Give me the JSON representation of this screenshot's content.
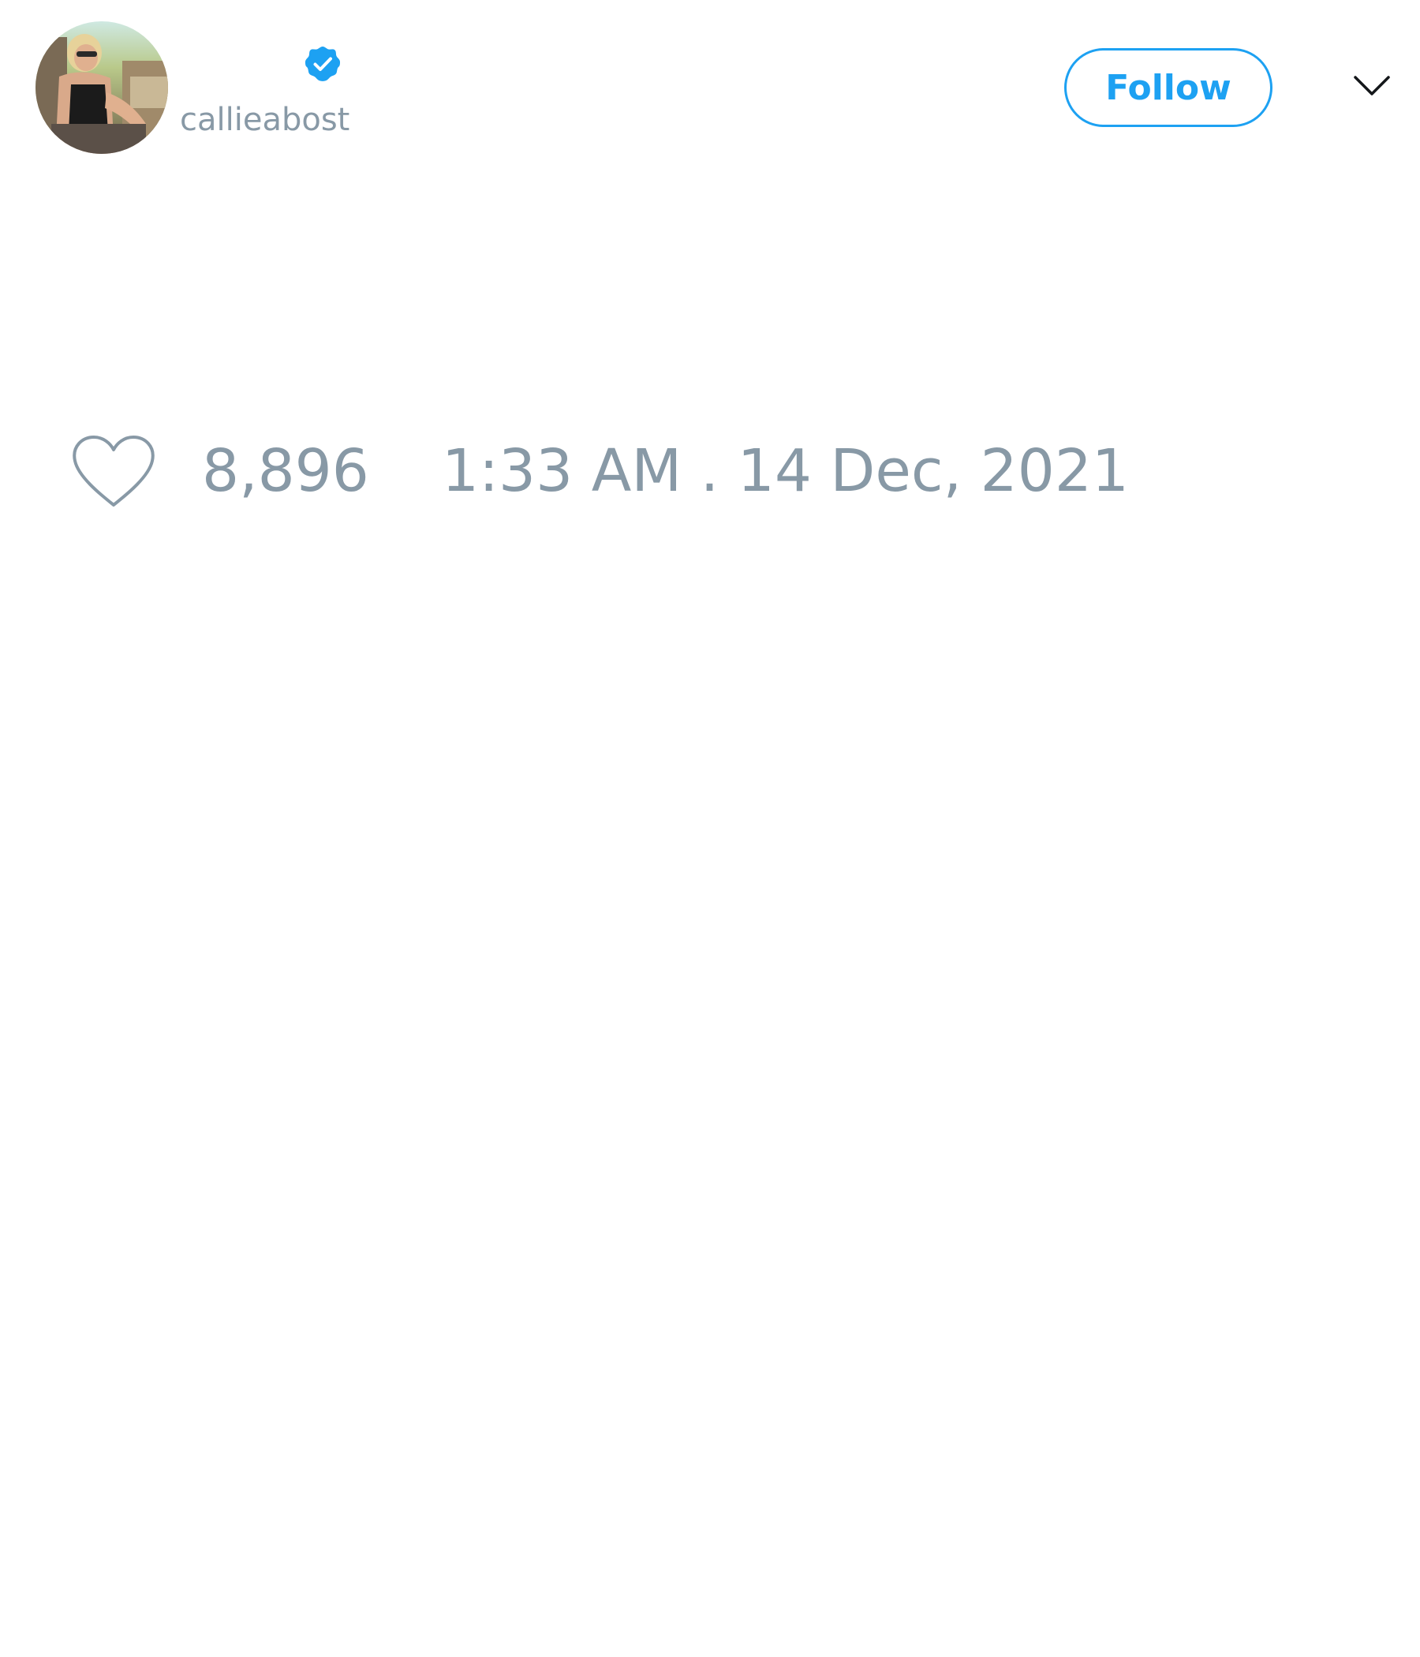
{
  "tweet": {
    "author": {
      "handle": "callieabost",
      "verified": true,
      "avatar_icon": "profile-photo"
    },
    "follow_label": "Follow",
    "menu_icon": "chevron-down-icon",
    "like_icon": "heart-icon",
    "likes": "8,896",
    "timestamp": "1:33 AM . 14 Dec, 2021"
  },
  "colors": {
    "accent": "#1da1f2",
    "muted_text": "#8899a6",
    "background": "#ffffff"
  }
}
